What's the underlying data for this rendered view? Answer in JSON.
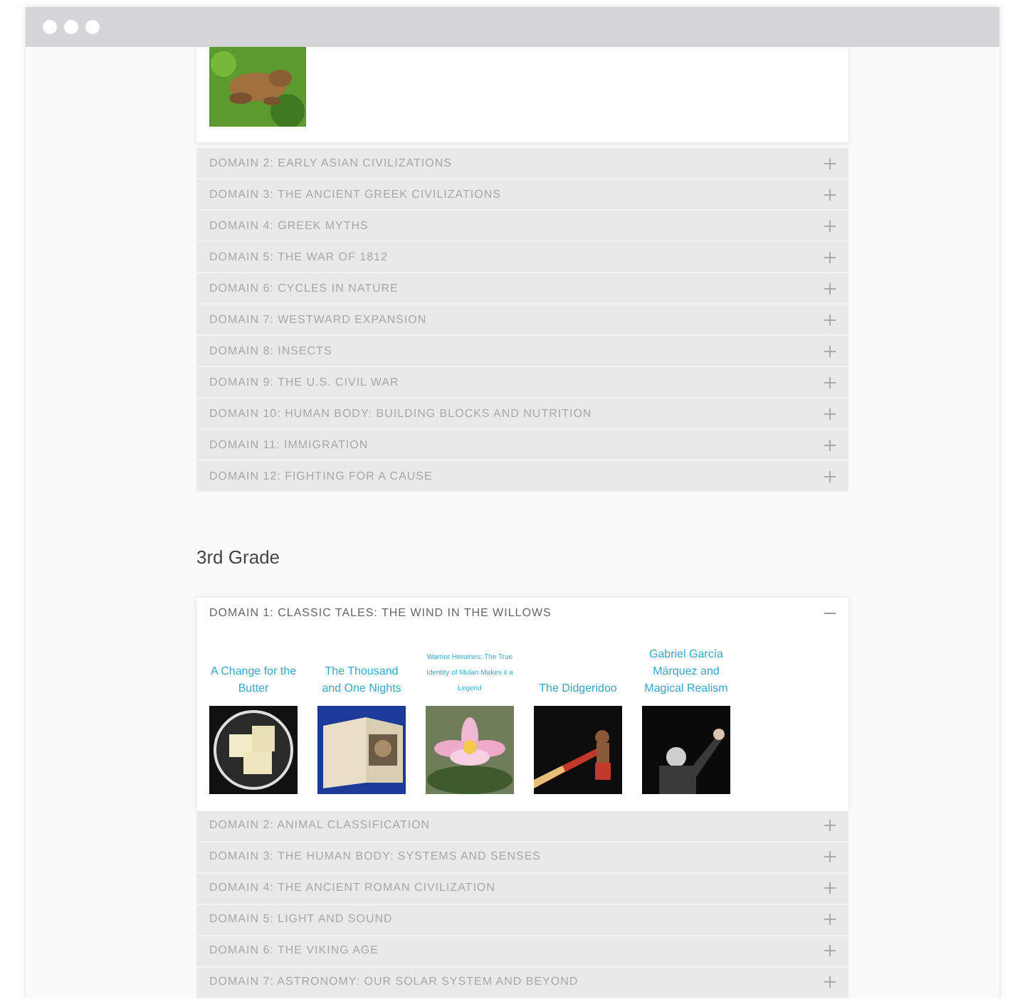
{
  "grade_2_domains": [
    {
      "title": "DOMAIN 2: EARLY ASIAN CIVILIZATIONS",
      "expanded": false
    },
    {
      "title": "DOMAIN 3: THE ANCIENT GREEK CIVILIZATIONS",
      "expanded": false
    },
    {
      "title": "DOMAIN 4: GREEK MYTHS",
      "expanded": false
    },
    {
      "title": "DOMAIN 5: THE WAR OF 1812",
      "expanded": false
    },
    {
      "title": "DOMAIN 6: CYCLES IN NATURE",
      "expanded": false
    },
    {
      "title": "DOMAIN 7: WESTWARD EXPANSION",
      "expanded": false
    },
    {
      "title": "DOMAIN 8: INSECTS",
      "expanded": false
    },
    {
      "title": "DOMAIN 9: THE U.S. CIVIL WAR",
      "expanded": false
    },
    {
      "title": "DOMAIN 10: HUMAN BODY: BUILDING BLOCKS AND NUTRITION",
      "expanded": false
    },
    {
      "title": "DOMAIN 11: IMMIGRATION",
      "expanded": false
    },
    {
      "title": "DOMAIN 12: FIGHTING FOR A CAUSE",
      "expanded": false
    }
  ],
  "grade_3": {
    "heading": "3rd Grade",
    "domains": [
      {
        "title": "DOMAIN 1: CLASSIC TALES: THE WIND IN THE WILLOWS",
        "expanded": true,
        "stories": [
          {
            "title": "A Change for the Butter",
            "kind": "normal"
          },
          {
            "title": "The Thousand and One Nights",
            "kind": "normal"
          },
          {
            "title": "Warrior Heroines: The True Identity of Mulan Makes it a Legend",
            "kind": "small"
          },
          {
            "title": "The Didgeridoo",
            "kind": "normal"
          },
          {
            "title": "Gabriel García Márquez and Magical Realism",
            "kind": "normal"
          }
        ]
      },
      {
        "title": "DOMAIN 2: ANIMAL CLASSIFICATION",
        "expanded": false
      },
      {
        "title": "DOMAIN 3: THE HUMAN BODY: SYSTEMS AND SENSES",
        "expanded": false
      },
      {
        "title": "DOMAIN 4: THE ANCIENT ROMAN CIVILIZATION",
        "expanded": false
      },
      {
        "title": "DOMAIN 5: LIGHT AND SOUND",
        "expanded": false
      },
      {
        "title": "DOMAIN 6: THE VIKING AGE",
        "expanded": false
      },
      {
        "title": "DOMAIN 7: ASTRONOMY: OUR SOLAR SYSTEM AND BEYOND",
        "expanded": false
      }
    ]
  }
}
